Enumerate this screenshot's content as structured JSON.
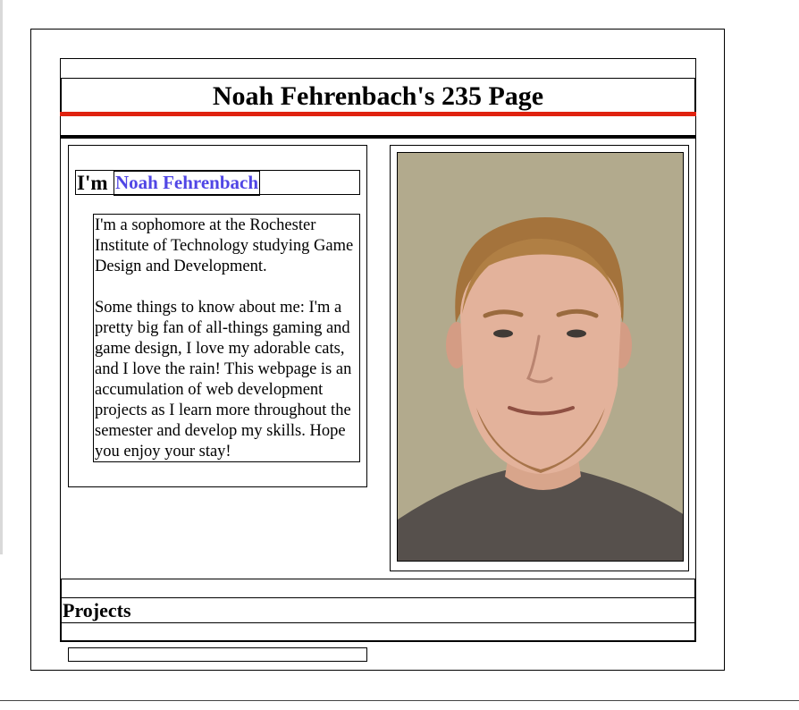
{
  "header": {
    "title": "Noah Fehrenbach's 235 Page"
  },
  "about": {
    "intro_prefix": "I'm",
    "intro_name": "Noah Fehrenbach",
    "bio_paragraphs": [
      "I'm a sophomore at the Rochester Institute of Technology studying Game Design and Development.",
      "Some things to know about me: I'm a pretty big fan of all-things gaming and game design, I love my adorable cats, and I love the rain! This webpage is an accumulation of web development projects as I learn more throughout the semester and develop my skills. Hope you enjoy your stay!"
    ]
  },
  "projects": {
    "heading": "Projects"
  },
  "colors": {
    "accent_red": "#e0220f",
    "name_link": "#5046e5",
    "photo_background": "#b3ab8f"
  }
}
